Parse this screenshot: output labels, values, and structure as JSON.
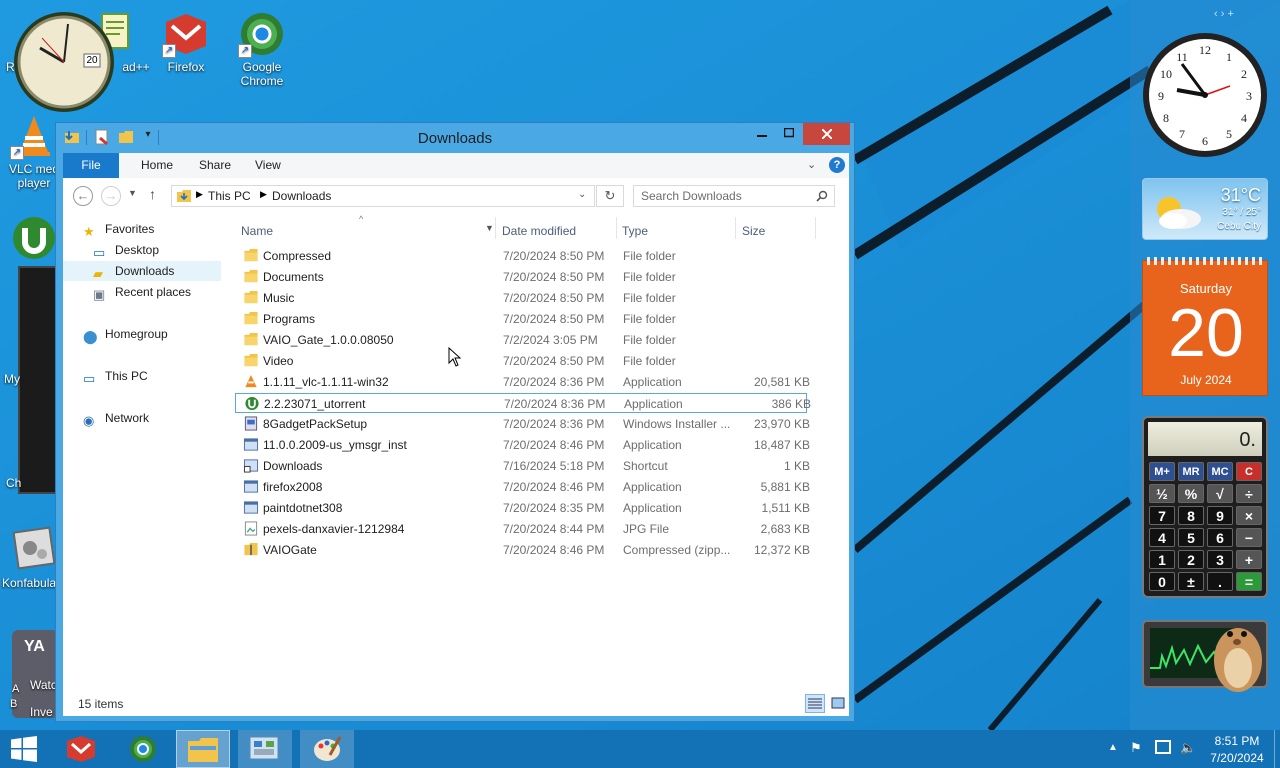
{
  "desktop": {
    "icons": [
      {
        "name": "recycle-bin",
        "label": "R"
      },
      {
        "name": "notepad-plus-plus",
        "label": "ad++"
      },
      {
        "name": "firefox",
        "label": "Firefox"
      },
      {
        "name": "google-chrome",
        "label": "Google Chrome"
      },
      {
        "name": "vlc",
        "label": "VLC med player"
      },
      {
        "name": "utorrent",
        "label": ""
      },
      {
        "name": "konfabulator",
        "label": "Konfabula"
      }
    ],
    "clock_gadget_date": "20",
    "edge_fragments": [
      "My",
      "Ch",
      "A",
      "Watc",
      "B",
      "Inve"
    ]
  },
  "gadgets": {
    "weather": {
      "temp": "31°C",
      "range": "31° / 25°",
      "city": "Cebu City"
    },
    "calendar": {
      "weekday": "Saturday",
      "day": "20",
      "month_year": "July 2024"
    },
    "calculator": {
      "display": "0.",
      "rows": [
        [
          "M+",
          "MR",
          "MC",
          "C"
        ],
        [
          "½",
          "%",
          "√",
          "÷"
        ],
        [
          "7",
          "8",
          "9",
          "×"
        ],
        [
          "4",
          "5",
          "6",
          "−"
        ],
        [
          "1",
          "2",
          "3",
          "+"
        ],
        [
          "0",
          "±",
          ".",
          "="
        ]
      ]
    }
  },
  "explorer": {
    "title": "Downloads",
    "tabs": [
      "File",
      "Home",
      "Share",
      "View"
    ],
    "breadcrumb": [
      "This PC",
      "Downloads"
    ],
    "search_placeholder": "Search Downloads",
    "nav": {
      "favorites": "Favorites",
      "desktop": "Desktop",
      "downloads": "Downloads",
      "recent": "Recent places",
      "homegroup": "Homegroup",
      "thispc": "This PC",
      "network": "Network"
    },
    "columns": {
      "name": "Name",
      "date": "Date modified",
      "type": "Type",
      "size": "Size"
    },
    "files": [
      {
        "name": "Compressed",
        "date": "7/20/2024 8:50 PM",
        "type": "File folder",
        "size": "",
        "icon": "folder-icon"
      },
      {
        "name": "Documents",
        "date": "7/20/2024 8:50 PM",
        "type": "File folder",
        "size": "",
        "icon": "folder-icon"
      },
      {
        "name": "Music",
        "date": "7/20/2024 8:50 PM",
        "type": "File folder",
        "size": "",
        "icon": "folder-icon"
      },
      {
        "name": "Programs",
        "date": "7/20/2024 8:50 PM",
        "type": "File folder",
        "size": "",
        "icon": "folder-icon"
      },
      {
        "name": "VAIO_Gate_1.0.0.08050",
        "date": "7/2/2024 3:05 PM",
        "type": "File folder",
        "size": "",
        "icon": "folder-icon"
      },
      {
        "name": "Video",
        "date": "7/20/2024 8:50 PM",
        "type": "File folder",
        "size": "",
        "icon": "folder-icon"
      },
      {
        "name": "1.1.11_vlc-1.1.11-win32",
        "date": "7/20/2024 8:36 PM",
        "type": "Application",
        "size": "20,581 KB",
        "icon": "vlc-icon"
      },
      {
        "name": "2.2.23071_utorrent",
        "date": "7/20/2024 8:36 PM",
        "type": "Application",
        "size": "386 KB",
        "icon": "utorrent-icon"
      },
      {
        "name": "8GadgetPackSetup",
        "date": "7/20/2024 8:36 PM",
        "type": "Windows Installer ...",
        "size": "23,970 KB",
        "icon": "installer-icon"
      },
      {
        "name": "11.0.0.2009-us_ymsgr_inst",
        "date": "7/20/2024 8:46 PM",
        "type": "Application",
        "size": "18,487 KB",
        "icon": "application-icon"
      },
      {
        "name": "Downloads",
        "date": "7/16/2024 5:18 PM",
        "type": "Shortcut",
        "size": "1 KB",
        "icon": "shortcut-icon"
      },
      {
        "name": "firefox2008",
        "date": "7/20/2024 8:46 PM",
        "type": "Application",
        "size": "5,881 KB",
        "icon": "application-icon"
      },
      {
        "name": "paintdotnet308",
        "date": "7/20/2024 8:35 PM",
        "type": "Application",
        "size": "1,511 KB",
        "icon": "application-icon"
      },
      {
        "name": "pexels-danxavier-1212984",
        "date": "7/20/2024 8:44 PM",
        "type": "JPG File",
        "size": "2,683 KB",
        "icon": "image-file-icon"
      },
      {
        "name": "VAIOGate",
        "date": "7/20/2024 8:46 PM",
        "type": "Compressed (zipp...",
        "size": "12,372 KB",
        "icon": "zip-folder-icon"
      }
    ],
    "selected_index": 7,
    "status": "15 items"
  },
  "taskbar": {
    "time": "8:51 PM",
    "date": "7/20/2024",
    "apps": [
      "firefox",
      "chrome",
      "file-explorer",
      "control-panel",
      "paint"
    ]
  }
}
